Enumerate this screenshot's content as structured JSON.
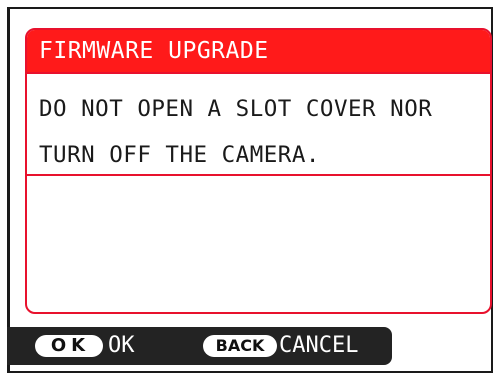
{
  "dialog": {
    "title": "FIRMWARE UPGRADE",
    "message_lines": [
      "DO NOT OPEN A SLOT COVER NOR",
      "TURN OFF THE CAMERA."
    ]
  },
  "footer": {
    "ok_key": "OK",
    "ok_label": "OK",
    "back_key": "BACK",
    "cancel_label": "CANCEL"
  },
  "colors": {
    "title_bar": "#ff1a1a",
    "dialog_border": "#e8112d",
    "footer_bg": "#232323",
    "text": "#1a1a1a"
  }
}
